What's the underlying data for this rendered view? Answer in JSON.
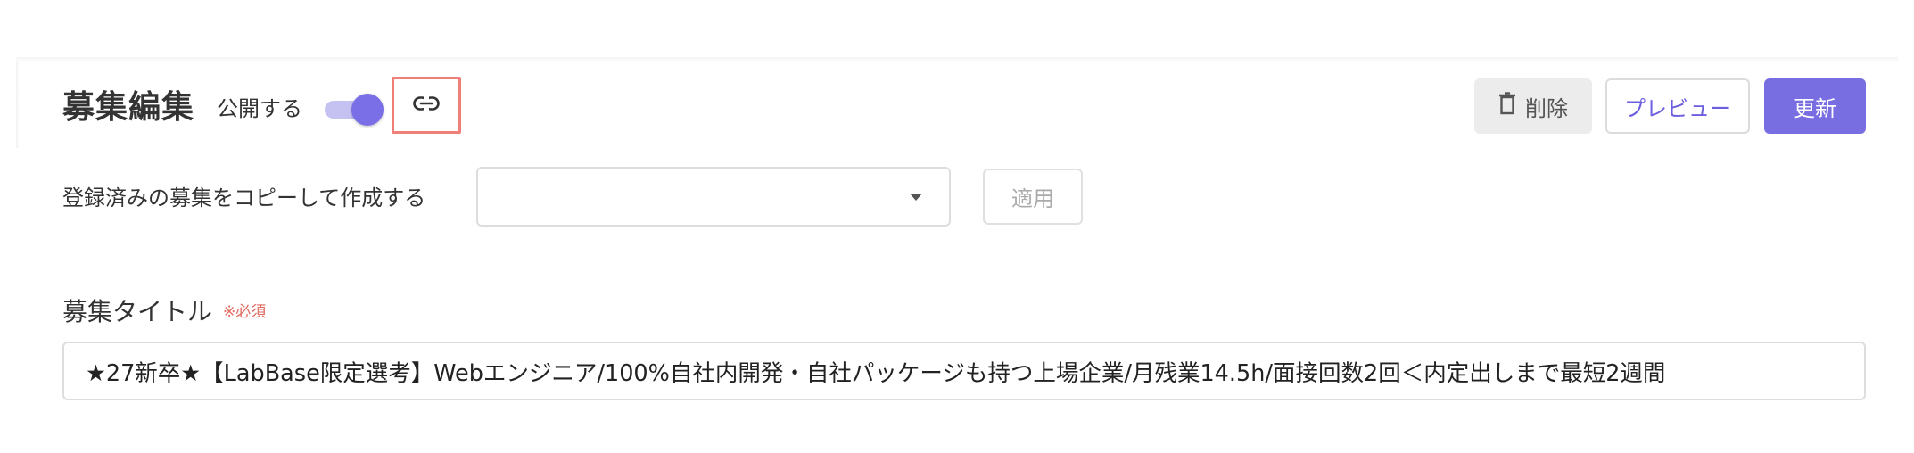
{
  "header": {
    "title": "募集編集",
    "publish_label": "公開する",
    "publish_enabled": true,
    "link_icon": "link-icon",
    "delete_icon": "trash-icon",
    "delete_label": "削除",
    "preview_label": "プレビュー",
    "update_label": "更新"
  },
  "copy": {
    "label": "登録済みの募集をコピーして作成する",
    "selected_value": "",
    "apply_label": "適用"
  },
  "title_field": {
    "label": "募集タイトル",
    "required_mark": "※必須",
    "value": "★27新卒★【LabBase限定選考】Webエンジニア/100%自社内開発・自社パッケージも持つ上場企業/月残業14.5h/面接回数2回＜内定出しまで最短2週間"
  },
  "colors": {
    "accent": "#786ee2",
    "toggle_track": "#c5c2f2",
    "highlight_border": "#ef7f77",
    "required": "#e26a5f"
  }
}
